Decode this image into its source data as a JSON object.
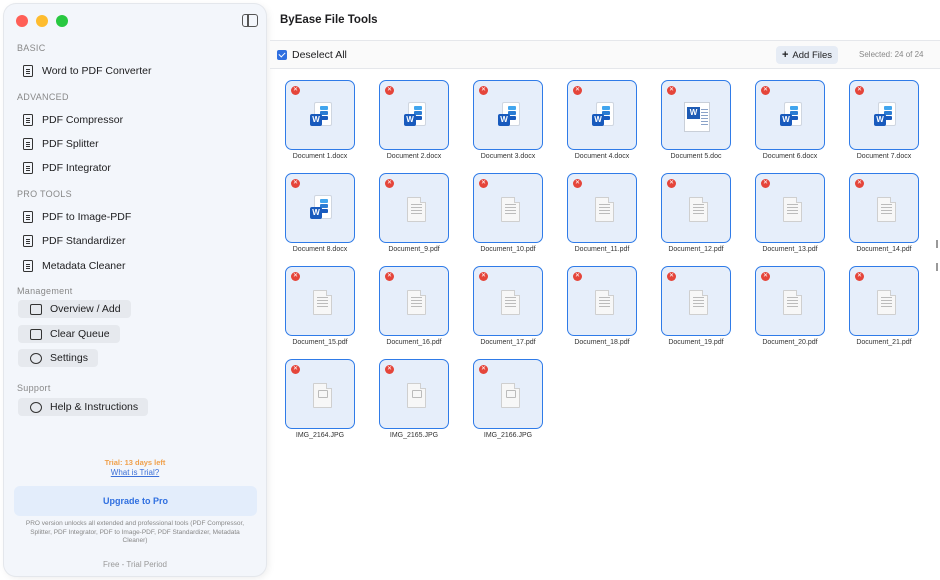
{
  "app": {
    "title": "ByEase File Tools"
  },
  "sidebar": {
    "sections": {
      "basic": "BASIC",
      "advanced": "ADVANCED",
      "pro_tools": "PRO TOOLS",
      "management": "Management",
      "support": "Support"
    },
    "basic_items": [
      {
        "label": "Word to PDF Converter",
        "icon": "document-icon"
      }
    ],
    "advanced_items": [
      {
        "label": "PDF Compressor",
        "icon": "compress-icon"
      },
      {
        "label": "PDF Splitter",
        "icon": "split-icon"
      },
      {
        "label": "PDF Integrator",
        "icon": "merge-icon"
      }
    ],
    "pro_items": [
      {
        "label": "PDF to Image-PDF",
        "icon": "image-icon"
      },
      {
        "label": "PDF Standardizer",
        "icon": "standardize-icon"
      },
      {
        "label": "Metadata Cleaner",
        "icon": "clean-icon"
      }
    ],
    "management_items": [
      {
        "label": "Overview / Add",
        "icon": "folder-add-icon"
      },
      {
        "label": "Clear Queue",
        "icon": "trash-icon"
      },
      {
        "label": "Settings",
        "icon": "gear-icon"
      }
    ],
    "support_items": [
      {
        "label": "Help & Instructions",
        "icon": "help-icon"
      }
    ],
    "trial": "Trial: 13 days left",
    "trial_link": "What is Trial?",
    "upgrade": "Upgrade to Pro",
    "pro_description": "PRO version unlocks all extended and professional tools (PDF Compressor, Splitter, PDF Integrator, PDF to Image-PDF, PDF Standardizer, Metadata Cleaner)",
    "plan": "Free - Trial Period"
  },
  "toolbar": {
    "deselect_all": "Deselect All",
    "add_files": "Add Files",
    "selected": "Selected: 24 of 24"
  },
  "files": [
    {
      "name": "Document 1.docx",
      "type": "docx"
    },
    {
      "name": "Document 2.docx",
      "type": "docx"
    },
    {
      "name": "Document 3.docx",
      "type": "docx"
    },
    {
      "name": "Document 4.docx",
      "type": "docx"
    },
    {
      "name": "Document 5.doc",
      "type": "doc"
    },
    {
      "name": "Document 6.docx",
      "type": "docx"
    },
    {
      "name": "Document 7.docx",
      "type": "docx"
    },
    {
      "name": "Document 8.docx",
      "type": "docx"
    },
    {
      "name": "Document_9.pdf",
      "type": "pdf"
    },
    {
      "name": "Document_10.pdf",
      "type": "pdf"
    },
    {
      "name": "Document_11.pdf",
      "type": "pdf"
    },
    {
      "name": "Document_12.pdf",
      "type": "pdf"
    },
    {
      "name": "Document_13.pdf",
      "type": "pdf"
    },
    {
      "name": "Document_14.pdf",
      "type": "pdf"
    },
    {
      "name": "Document_15.pdf",
      "type": "pdf"
    },
    {
      "name": "Document_16.pdf",
      "type": "pdf"
    },
    {
      "name": "Document_17.pdf",
      "type": "pdf"
    },
    {
      "name": "Document_18.pdf",
      "type": "pdf"
    },
    {
      "name": "Document_19.pdf",
      "type": "pdf"
    },
    {
      "name": "Document_20.pdf",
      "type": "pdf"
    },
    {
      "name": "Document_21.pdf",
      "type": "pdf"
    },
    {
      "name": "IMG_2164.JPG",
      "type": "jpg"
    },
    {
      "name": "IMG_2165.JPG",
      "type": "jpg"
    },
    {
      "name": "IMG_2166.JPG",
      "type": "jpg"
    }
  ]
}
